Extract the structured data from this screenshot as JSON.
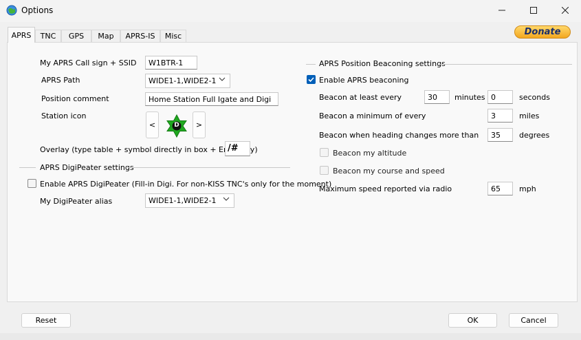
{
  "window": {
    "title": "Options"
  },
  "tabs": [
    "APRS",
    "TNC",
    "GPS",
    "Map",
    "APRS-IS",
    "Misc"
  ],
  "donate_label": "Donate",
  "left": {
    "callsign_label": "My APRS Call sign + SSID",
    "callsign_value": "W1BTR-1",
    "path_label": "APRS Path",
    "path_value": "WIDE1-1,WIDE2-1",
    "comment_label": "Position comment",
    "comment_value": "Home Station Full Igate and Digi",
    "icon_label": "Station icon",
    "icon_prev": "<",
    "icon_next": ">",
    "icon_letter": "D",
    "overlay_label": "Overlay (type table + symbol directly in box + Enter key)",
    "overlay_value": "/#",
    "digi_section": "APRS DigiPeater settings",
    "digi_enable_label": "Enable APRS DigiPeater (Fill-in Digi. For non-KISS TNC's only for the moment)",
    "digi_enable_checked": false,
    "digi_alias_label": "My DigiPeater alias",
    "digi_alias_value": "WIDE1-1,WIDE2-1"
  },
  "right": {
    "section": "APRS Position Beaconing settings",
    "enable_label": "Enable APRS beaconing",
    "enable_checked": true,
    "atleast_label": "Beacon at least every",
    "atleast_minutes": "30",
    "minutes_unit": "minutes",
    "atleast_seconds": "0",
    "seconds_unit": "seconds",
    "min_label": "Beacon a minimum of every",
    "min_value": "3",
    "miles_unit": "miles",
    "heading_label": "Beacon when heading changes more than",
    "heading_value": "35",
    "degrees_unit": "degrees",
    "altitude_label": "Beacon my altitude",
    "course_label": "Beacon my course and speed",
    "maxspeed_label": "Maximum speed reported via radio",
    "maxspeed_value": "65",
    "mph_unit": "mph"
  },
  "footer": {
    "reset": "Reset",
    "ok": "OK",
    "cancel": "Cancel"
  },
  "colors": {
    "accent": "#005fb8",
    "icon_green": "#1fa81f",
    "donate_top": "#ffd86b",
    "donate_bottom": "#f3a71f"
  }
}
